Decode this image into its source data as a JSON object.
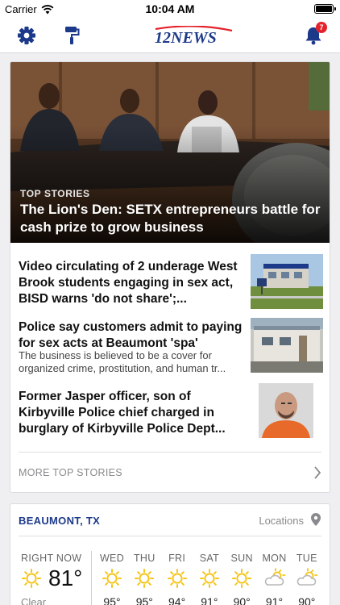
{
  "status_bar": {
    "carrier": "Carrier",
    "time": "10:04 AM"
  },
  "nav": {
    "logo_text": "12NEWS",
    "notification_count": "7",
    "icons": [
      "gear-icon",
      "paint-roller-icon",
      "bell-icon"
    ]
  },
  "hero": {
    "kicker": "TOP STORIES",
    "title": "The Lion's Den: SETX entrepreneurs battle for cash prize to grow business"
  },
  "stories": [
    {
      "title": "Video circulating of 2 underage West Brook students engaging in sex act, BISD warns 'do not share';...",
      "description": ""
    },
    {
      "title": "Police say customers admit to paying for sex acts at Beaumont 'spa'",
      "description": "The business is believed to be a cover for organized crime, prostitution, and human tr..."
    },
    {
      "title": "Former Jasper officer, son of Kirbyville Police chief charged in burglary of Kirbyville Police Dept...",
      "description": ""
    }
  ],
  "more_top_stories": "MORE TOP STORIES",
  "weather": {
    "city": "BEAUMONT, TX",
    "locations_label": "Locations",
    "now_label": "RIGHT NOW",
    "now_temp": "81°",
    "now_condition": "Clear",
    "days": [
      {
        "label": "WED",
        "icon": "sun-icon",
        "high": "95°"
      },
      {
        "label": "THU",
        "icon": "sun-icon",
        "high": "95°"
      },
      {
        "label": "FRI",
        "icon": "sun-icon",
        "high": "94°"
      },
      {
        "label": "SAT",
        "icon": "sun-icon",
        "high": "91°"
      },
      {
        "label": "SUN",
        "icon": "sun-icon",
        "high": "90°"
      },
      {
        "label": "MON",
        "icon": "partly-cloudy-icon",
        "high": "91°"
      },
      {
        "label": "TUE",
        "icon": "partly-cloudy-icon",
        "high": "90°"
      }
    ]
  },
  "colors": {
    "accent_blue": "#1d3a8a",
    "logo_red": "#e4222b",
    "sun_yellow": "#f5c518"
  }
}
